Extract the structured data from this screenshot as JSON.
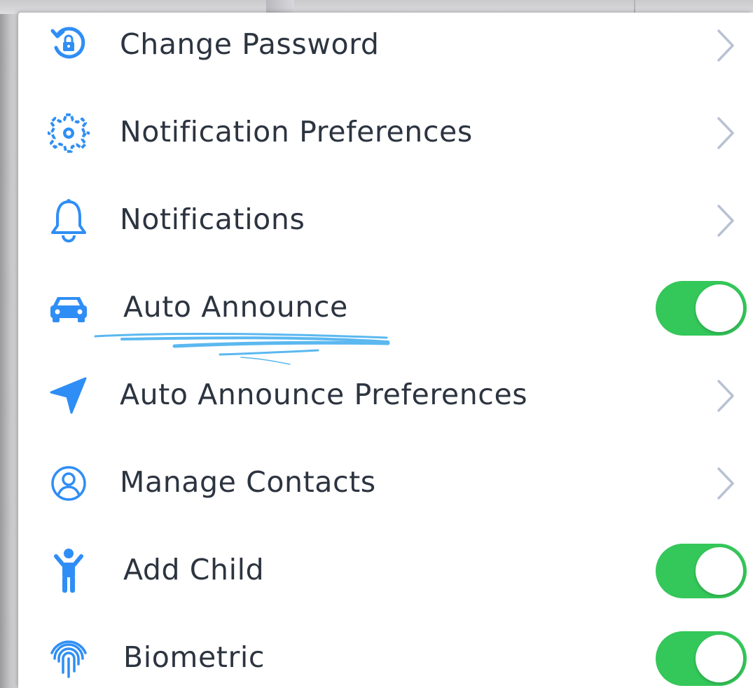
{
  "settings": {
    "items": [
      {
        "label": "Change Password",
        "icon": "lock-rotate-icon",
        "control": "chevron"
      },
      {
        "label": "Notification Preferences",
        "icon": "gear-icon",
        "control": "chevron"
      },
      {
        "label": "Notifications",
        "icon": "bell-icon",
        "control": "chevron"
      },
      {
        "label": "Auto Announce",
        "icon": "car-icon",
        "control": "toggle",
        "on": true
      },
      {
        "label": "Auto Announce Preferences",
        "icon": "location-arrow-icon",
        "control": "chevron"
      },
      {
        "label": "Manage Contacts",
        "icon": "user-circle-icon",
        "control": "chevron"
      },
      {
        "label": "Add Child",
        "icon": "child-icon",
        "control": "toggle",
        "on": true
      },
      {
        "label": "Biometric",
        "icon": "fingerprint-icon",
        "control": "toggle",
        "on": true
      }
    ]
  },
  "colors": {
    "icon_blue": "#2f8ef5",
    "toggle_green": "#34c759",
    "label_text": "#2c3440",
    "chevron_gray": "#b9c2d3",
    "highlight_scribble": "#5bb8f0"
  }
}
